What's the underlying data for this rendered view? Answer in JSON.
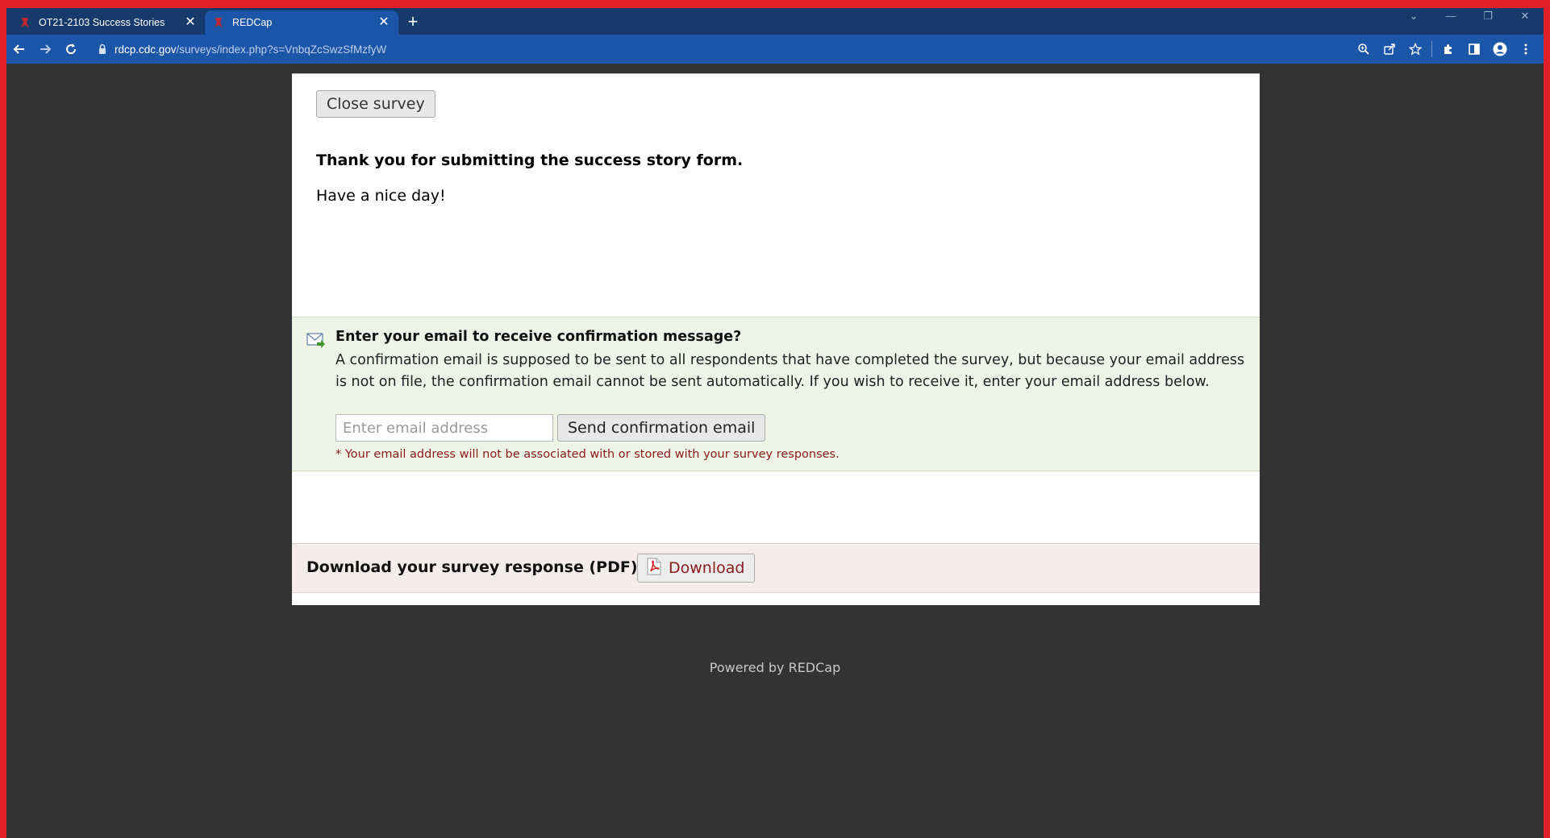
{
  "browser": {
    "tabs": [
      {
        "title": "OT21-2103 Success Stories",
        "active": false
      },
      {
        "title": "REDCap",
        "active": true
      }
    ],
    "url_host": "rdcp.cdc.gov",
    "url_path": "/surveys/index.php?s=VnbqZcSwzSfMzfyW"
  },
  "survey": {
    "close_label": "Close survey",
    "thanks_text": "Thank you for submitting the success story form.",
    "nice_day_text": "Have a nice day!"
  },
  "email_section": {
    "heading": "Enter your email to receive confirmation message?",
    "description": "A confirmation email is supposed to be sent to all respondents that have completed the survey, but because your email address is not on file, the confirmation email cannot be sent automatically. If you wish to receive it, enter your email address below.",
    "input_placeholder": "Enter email address",
    "input_value": "",
    "send_label": "Send confirmation email",
    "note": "* Your email address will not be associated with or stored with your survey responses."
  },
  "download_section": {
    "label": "Download your survey response (PDF):",
    "button_label": "Download"
  },
  "footer": {
    "powered_by": "Powered by REDCap"
  },
  "colors": {
    "chrome_tabstrip": "#163a6b",
    "chrome_toolbar": "#1c56a8",
    "page_background": "#333333",
    "email_panel": "#eef4e6",
    "download_panel": "#f5ecec",
    "note_red": "#8b1a1a"
  }
}
